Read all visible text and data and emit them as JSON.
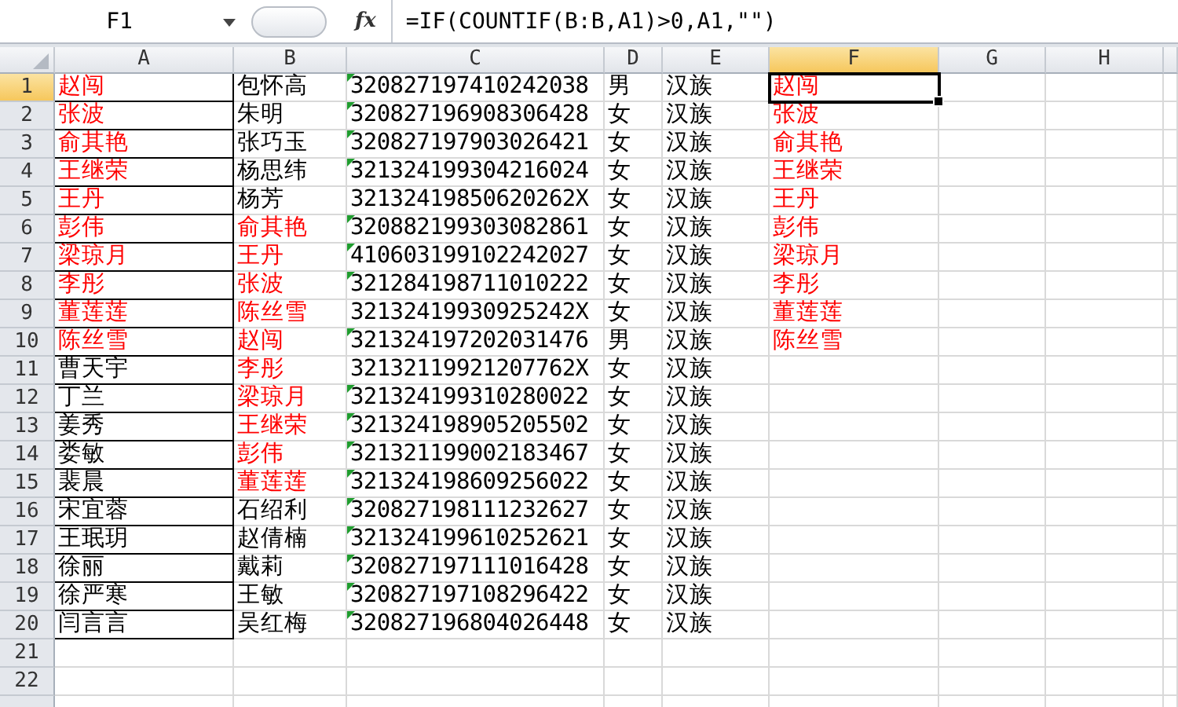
{
  "formula_bar": {
    "name_box": "F1",
    "fx_label": "fx",
    "formula": "=IF(COUNTIF(B:B,A1)>0,A1,\"\")"
  },
  "columns": [
    {
      "label": "A",
      "selected": false
    },
    {
      "label": "B",
      "selected": false
    },
    {
      "label": "C",
      "selected": false
    },
    {
      "label": "D",
      "selected": false
    },
    {
      "label": "E",
      "selected": false
    },
    {
      "label": "F",
      "selected": true
    },
    {
      "label": "G",
      "selected": false
    },
    {
      "label": "H",
      "selected": false
    }
  ],
  "rows": [
    {
      "number": "1",
      "selected": true,
      "cells": [
        {
          "text": "赵闯",
          "highlighted": true,
          "bordered": true
        },
        {
          "text": "包怀高",
          "highlighted": false
        },
        {
          "text": "320827197410242038",
          "highlighted": false,
          "flagged": true
        },
        {
          "text": "男",
          "highlighted": false
        },
        {
          "text": "汉族",
          "highlighted": false
        },
        {
          "text": "赵闯",
          "highlighted": true
        }
      ]
    },
    {
      "number": "2",
      "selected": false,
      "cells": [
        {
          "text": "张波",
          "highlighted": true,
          "bordered": true
        },
        {
          "text": "朱明",
          "highlighted": false
        },
        {
          "text": "320827196908306428",
          "highlighted": false,
          "flagged": true
        },
        {
          "text": "女",
          "highlighted": false
        },
        {
          "text": "汉族",
          "highlighted": false
        },
        {
          "text": "张波",
          "highlighted": true
        }
      ]
    },
    {
      "number": "3",
      "selected": false,
      "cells": [
        {
          "text": "俞其艳",
          "highlighted": true,
          "bordered": true
        },
        {
          "text": "张巧玉",
          "highlighted": false
        },
        {
          "text": "320827197903026421",
          "highlighted": false,
          "flagged": true
        },
        {
          "text": "女",
          "highlighted": false
        },
        {
          "text": "汉族",
          "highlighted": false
        },
        {
          "text": "俞其艳",
          "highlighted": true
        }
      ]
    },
    {
      "number": "4",
      "selected": false,
      "cells": [
        {
          "text": "王继荣",
          "highlighted": true,
          "bordered": true
        },
        {
          "text": "杨思纬",
          "highlighted": false
        },
        {
          "text": "321324199304216024",
          "highlighted": false,
          "flagged": true
        },
        {
          "text": "女",
          "highlighted": false
        },
        {
          "text": "汉族",
          "highlighted": false
        },
        {
          "text": "王继荣",
          "highlighted": true
        }
      ]
    },
    {
      "number": "5",
      "selected": false,
      "cells": [
        {
          "text": "王丹",
          "highlighted": true,
          "bordered": true
        },
        {
          "text": "杨芳",
          "highlighted": false
        },
        {
          "text": "32132419850620262X",
          "highlighted": false,
          "flagged": false
        },
        {
          "text": "女",
          "highlighted": false
        },
        {
          "text": "汉族",
          "highlighted": false
        },
        {
          "text": "王丹",
          "highlighted": true
        }
      ]
    },
    {
      "number": "6",
      "selected": false,
      "cells": [
        {
          "text": "彭伟",
          "highlighted": true,
          "bordered": true
        },
        {
          "text": "俞其艳",
          "highlighted": true
        },
        {
          "text": "320882199303082861",
          "highlighted": false,
          "flagged": true
        },
        {
          "text": "女",
          "highlighted": false
        },
        {
          "text": "汉族",
          "highlighted": false
        },
        {
          "text": "彭伟",
          "highlighted": true
        }
      ]
    },
    {
      "number": "7",
      "selected": false,
      "cells": [
        {
          "text": "梁琼月",
          "highlighted": true,
          "bordered": true
        },
        {
          "text": "王丹",
          "highlighted": true
        },
        {
          "text": "410603199102242027",
          "highlighted": false,
          "flagged": true
        },
        {
          "text": "女",
          "highlighted": false
        },
        {
          "text": "汉族",
          "highlighted": false
        },
        {
          "text": "梁琼月",
          "highlighted": true
        }
      ]
    },
    {
      "number": "8",
      "selected": false,
      "cells": [
        {
          "text": "李彤",
          "highlighted": true,
          "bordered": true
        },
        {
          "text": "张波",
          "highlighted": true
        },
        {
          "text": "321284198711010222",
          "highlighted": false,
          "flagged": true
        },
        {
          "text": "女",
          "highlighted": false
        },
        {
          "text": "汉族",
          "highlighted": false
        },
        {
          "text": "李彤",
          "highlighted": true
        }
      ]
    },
    {
      "number": "9",
      "selected": false,
      "cells": [
        {
          "text": "董莲莲",
          "highlighted": true,
          "bordered": true
        },
        {
          "text": "陈丝雪",
          "highlighted": true
        },
        {
          "text": "32132419930925242X",
          "highlighted": false,
          "flagged": false
        },
        {
          "text": "女",
          "highlighted": false
        },
        {
          "text": "汉族",
          "highlighted": false
        },
        {
          "text": "董莲莲",
          "highlighted": true
        }
      ]
    },
    {
      "number": "10",
      "selected": false,
      "cells": [
        {
          "text": "陈丝雪",
          "highlighted": true,
          "bordered": true
        },
        {
          "text": "赵闯",
          "highlighted": true
        },
        {
          "text": "321324197202031476",
          "highlighted": false,
          "flagged": true
        },
        {
          "text": "男",
          "highlighted": false
        },
        {
          "text": "汉族",
          "highlighted": false
        },
        {
          "text": "陈丝雪",
          "highlighted": true
        }
      ]
    },
    {
      "number": "11",
      "selected": false,
      "cells": [
        {
          "text": "曹天宇",
          "highlighted": false,
          "bordered": true
        },
        {
          "text": "李彤",
          "highlighted": true
        },
        {
          "text": "32132119921207762X",
          "highlighted": false,
          "flagged": false
        },
        {
          "text": "女",
          "highlighted": false
        },
        {
          "text": "汉族",
          "highlighted": false
        }
      ]
    },
    {
      "number": "12",
      "selected": false,
      "cells": [
        {
          "text": "丁兰",
          "highlighted": false,
          "bordered": true
        },
        {
          "text": "梁琼月",
          "highlighted": true
        },
        {
          "text": "321324199310280022",
          "highlighted": false,
          "flagged": true
        },
        {
          "text": "女",
          "highlighted": false
        },
        {
          "text": "汉族",
          "highlighted": false
        }
      ]
    },
    {
      "number": "13",
      "selected": false,
      "cells": [
        {
          "text": "姜秀",
          "highlighted": false,
          "bordered": true
        },
        {
          "text": "王继荣",
          "highlighted": true
        },
        {
          "text": "321324198905205502",
          "highlighted": false,
          "flagged": true
        },
        {
          "text": "女",
          "highlighted": false
        },
        {
          "text": "汉族",
          "highlighted": false
        }
      ]
    },
    {
      "number": "14",
      "selected": false,
      "cells": [
        {
          "text": "娄敏",
          "highlighted": false,
          "bordered": true
        },
        {
          "text": "彭伟",
          "highlighted": true
        },
        {
          "text": "321321199002183467",
          "highlighted": false,
          "flagged": true
        },
        {
          "text": "女",
          "highlighted": false
        },
        {
          "text": "汉族",
          "highlighted": false
        }
      ]
    },
    {
      "number": "15",
      "selected": false,
      "cells": [
        {
          "text": "裴晨",
          "highlighted": false,
          "bordered": true
        },
        {
          "text": "董莲莲",
          "highlighted": true
        },
        {
          "text": "321324198609256022",
          "highlighted": false,
          "flagged": true
        },
        {
          "text": "女",
          "highlighted": false
        },
        {
          "text": "汉族",
          "highlighted": false
        }
      ]
    },
    {
      "number": "16",
      "selected": false,
      "cells": [
        {
          "text": "宋宜蓉",
          "highlighted": false,
          "bordered": true
        },
        {
          "text": "石绍利",
          "highlighted": false
        },
        {
          "text": "320827198111232627",
          "highlighted": false,
          "flagged": true
        },
        {
          "text": "女",
          "highlighted": false
        },
        {
          "text": "汉族",
          "highlighted": false
        }
      ]
    },
    {
      "number": "17",
      "selected": false,
      "cells": [
        {
          "text": "王珉玥",
          "highlighted": false,
          "bordered": true
        },
        {
          "text": "赵倩楠",
          "highlighted": false
        },
        {
          "text": "321324199610252621",
          "highlighted": false,
          "flagged": true
        },
        {
          "text": "女",
          "highlighted": false
        },
        {
          "text": "汉族",
          "highlighted": false
        }
      ]
    },
    {
      "number": "18",
      "selected": false,
      "cells": [
        {
          "text": "徐丽",
          "highlighted": false,
          "bordered": true
        },
        {
          "text": "戴莉",
          "highlighted": false
        },
        {
          "text": "320827197111016428",
          "highlighted": false,
          "flagged": true
        },
        {
          "text": "女",
          "highlighted": false
        },
        {
          "text": "汉族",
          "highlighted": false
        }
      ]
    },
    {
      "number": "19",
      "selected": false,
      "cells": [
        {
          "text": "徐严寒",
          "highlighted": false,
          "bordered": true
        },
        {
          "text": "王敏",
          "highlighted": false
        },
        {
          "text": "320827197108296422",
          "highlighted": false,
          "flagged": true
        },
        {
          "text": "女",
          "highlighted": false
        },
        {
          "text": "汉族",
          "highlighted": false
        }
      ]
    },
    {
      "number": "20",
      "selected": false,
      "cells": [
        {
          "text": "闫言言",
          "highlighted": false,
          "bordered": true
        },
        {
          "text": "吴红梅",
          "highlighted": false
        },
        {
          "text": "320827196804026448",
          "highlighted": false,
          "flagged": true
        },
        {
          "text": "女",
          "highlighted": false
        },
        {
          "text": "汉族",
          "highlighted": false
        }
      ]
    },
    {
      "number": "21",
      "selected": false
    },
    {
      "number": "22",
      "selected": false
    }
  ]
}
